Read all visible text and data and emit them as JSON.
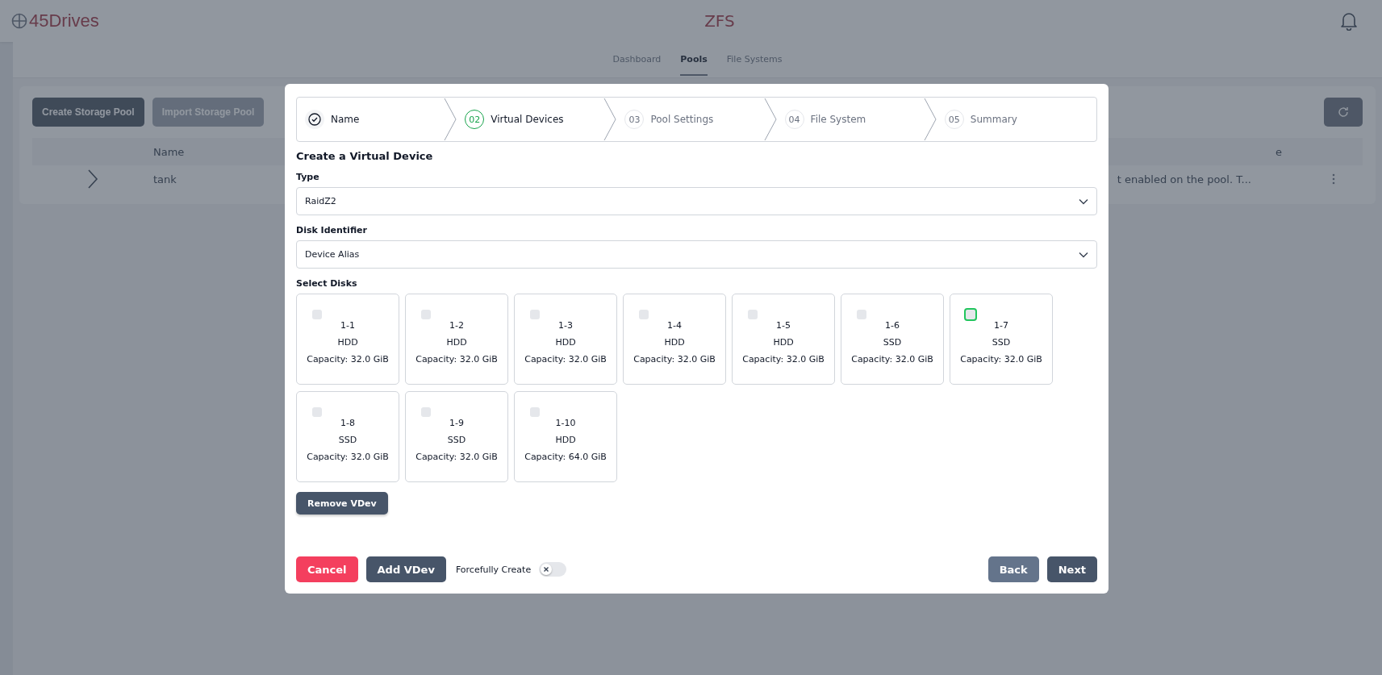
{
  "header": {
    "logo": "45Drives",
    "title": "ZFS"
  },
  "nav_tabs": [
    {
      "label": "Dashboard",
      "selected": false
    },
    {
      "label": "Pools",
      "selected": true
    },
    {
      "label": "File Systems",
      "selected": false
    }
  ],
  "toolbar": {
    "buttons": [
      "Create Storage Pool",
      "Import Storage Pool"
    ]
  },
  "table": {
    "columns": [
      "Name",
      "e"
    ],
    "rows": [
      {
        "name": "tank",
        "column_2": "t enabled on the pool. T...",
        "expanded": false
      }
    ]
  },
  "dialog": {
    "steps": [
      {
        "label": "Name",
        "completed": true,
        "selected": false
      },
      {
        "number": "02",
        "label": "Virtual Devices",
        "completed": false,
        "selected": true
      },
      {
        "number": "03",
        "label": "Pool Settings",
        "completed": false,
        "selected": false
      },
      {
        "number": "04",
        "label": "File System",
        "completed": false,
        "selected": false
      },
      {
        "number": "05",
        "label": "Summary",
        "completed": false,
        "selected": false
      }
    ],
    "heading": "Create a Virtual Device",
    "type": {
      "label": "Type",
      "value": "RaidZ2"
    },
    "disk_identifier": {
      "label": "Disk Identifier",
      "value": "Device Alias"
    },
    "select_disks_label": "Select Disks",
    "disks": [
      {
        "name": "1-1",
        "type": "HDD",
        "capacity": "Capacity: 32.0 GiB",
        "checked": false,
        "focused": false
      },
      {
        "name": "1-2",
        "type": "HDD",
        "capacity": "Capacity: 32.0 GiB",
        "checked": false,
        "focused": false
      },
      {
        "name": "1-3",
        "type": "HDD",
        "capacity": "Capacity: 32.0 GiB",
        "checked": false,
        "focused": false
      },
      {
        "name": "1-4",
        "type": "HDD",
        "capacity": "Capacity: 32.0 GiB",
        "checked": false,
        "focused": false
      },
      {
        "name": "1-5",
        "type": "HDD",
        "capacity": "Capacity: 32.0 GiB",
        "checked": false,
        "focused": false
      },
      {
        "name": "1-6",
        "type": "SSD",
        "capacity": "Capacity: 32.0 GiB",
        "checked": false,
        "focused": false
      },
      {
        "name": "1-7",
        "type": "SSD",
        "capacity": "Capacity: 32.0 GiB",
        "checked": false,
        "focused": true
      },
      {
        "name": "1-8",
        "type": "SSD",
        "capacity": "Capacity: 32.0 GiB",
        "checked": false,
        "focused": false
      },
      {
        "name": "1-9",
        "type": "SSD",
        "capacity": "Capacity: 32.0 GiB",
        "checked": false,
        "focused": false
      },
      {
        "name": "1-10",
        "type": "HDD",
        "capacity": "Capacity: 64.0 GiB",
        "checked": false,
        "focused": false
      }
    ],
    "remove_button": "Remove VDev",
    "cancel_button": "Cancel",
    "add_button": "Add VDev",
    "force_toggle": {
      "label": "Forcefully Create",
      "on": false
    },
    "back_button": "Back",
    "next_button": "Next"
  }
}
